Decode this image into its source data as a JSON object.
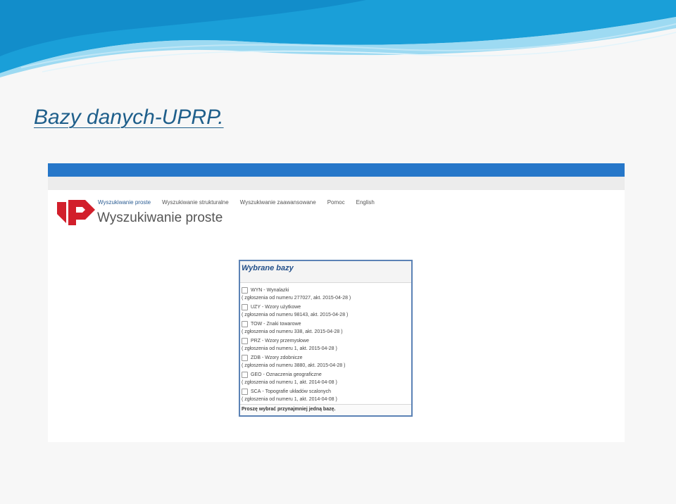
{
  "slide": {
    "title": "Bazy danych-UPRP.",
    "colors": {
      "title": "#1f5f8b",
      "wave_dark": "#1a9fd8",
      "wave_light": "#7fd0f0"
    }
  },
  "site": {
    "topbar_color": "#2677c9",
    "logo_color": "#d21f2b",
    "logo_icon": "uprp-logo-icon",
    "nav": {
      "items": [
        "Wyszukiwanie proste",
        "Wyszukiwanie strukturalne",
        "Wyszukiwanie zaawansowane",
        "Pomoc",
        "English"
      ],
      "active_index": 0
    },
    "page_heading": "Wyszukiwanie proste"
  },
  "panel": {
    "title": "Wybrane bazy",
    "databases": [
      {
        "code": "WYN",
        "name": "Wynalazki",
        "note": "( zgłoszenia od numeru 277027, akt. 2015-04-28 )"
      },
      {
        "code": "UZY",
        "name": "Wzory użytkowe",
        "note": "( zgłoszenia od numeru 98143, akt. 2015-04-28 )"
      },
      {
        "code": "TOW",
        "name": "Znaki towarowe",
        "note": "( zgłoszenia od numeru 338, akt. 2015-04-28 )"
      },
      {
        "code": "PRZ",
        "name": "Wzory przemysłowe",
        "note": "( zgłoszenia od numeru 1, akt. 2015-04-28 )"
      },
      {
        "code": "ZDB",
        "name": "Wzory zdobnicze",
        "note": "( zgłoszenia od numeru 3880, akt. 2015-04-28 )"
      },
      {
        "code": "GEO",
        "name": "Oznaczenia geograficzne",
        "note": "( zgłoszenia od numeru 1, akt. 2014-04-08 )"
      },
      {
        "code": "SCA",
        "name": "Topografie układów scalonych",
        "note": "( zgłoszenia od numeru 1, akt. 2014-04-08 )"
      }
    ],
    "footer": "Proszę wybrać przynajmniej jedną bazę."
  }
}
